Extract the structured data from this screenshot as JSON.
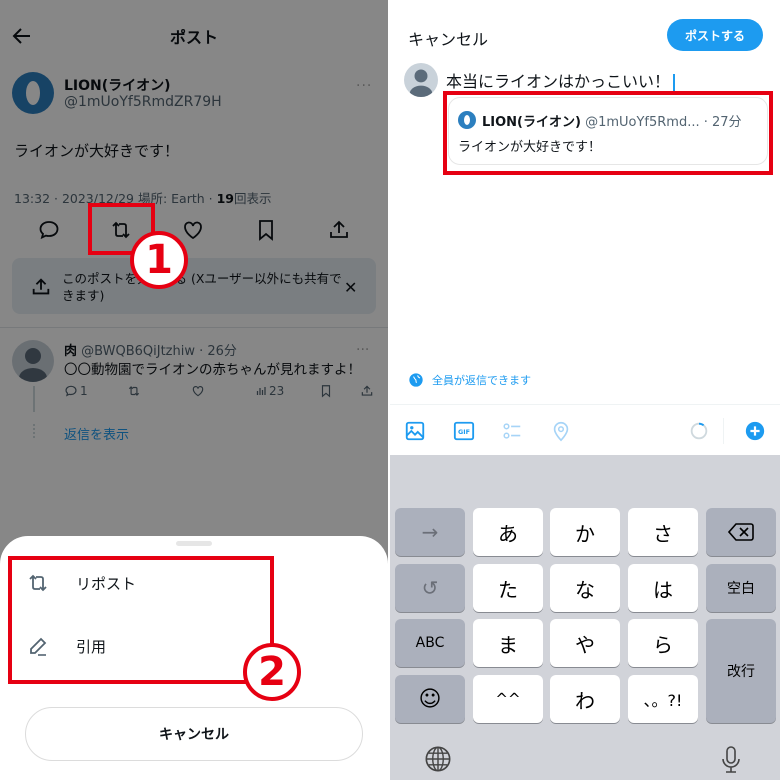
{
  "left": {
    "header": {
      "title": "ポスト"
    },
    "post": {
      "display_name": "LION(ライオン)",
      "handle": "@1mUoYf5RmdZR79H",
      "text": "ライオンが大好きです！",
      "meta_prefix": "13:32 · 2023/12/29 場所: Earth · ",
      "views_count": "19",
      "views_suffix": "回表示",
      "more": "···"
    },
    "actions": [
      "reply",
      "repost",
      "like",
      "bookmark",
      "share"
    ],
    "share_tip": {
      "text": "このポストを共有する (Xユーザー以外にも共有できます)",
      "close": "✕"
    },
    "reply": {
      "display_name": "肉",
      "handle_time": "@BWQB6QiJtzhiw · 26分",
      "text": "〇〇動物園でライオンの赤ちゃんが見れますよ！",
      "reply_count": "1",
      "views": "23",
      "more": "···"
    },
    "show_replies": "返信を表示",
    "sheet": {
      "items": [
        {
          "label": "リポスト",
          "icon": "repost-icon"
        },
        {
          "label": "引用",
          "icon": "pencil-icon"
        }
      ],
      "cancel": "キャンセル"
    },
    "annotations": {
      "step1": "1",
      "step2": "2",
      "accent": "#e60012"
    }
  },
  "right": {
    "cancel": "キャンセル",
    "post_button": "ポストする",
    "compose_text": "本当にライオンはかっこいい！",
    "quote": {
      "display_name": "LION(ライオン)",
      "handle_time": "@1mUoYf5Rmd... · 27分",
      "text": "ライオンが大好きです！"
    },
    "reply_setting": "全員が返信できます",
    "toolbar": [
      "image-icon",
      "gif-icon",
      "poll-icon",
      "location-icon",
      "char-counter",
      "add-post-icon"
    ],
    "keyboard": {
      "rows": [
        [
          "→",
          "あ",
          "か",
          "さ",
          "⌫"
        ],
        [
          "↺",
          "た",
          "な",
          "は",
          "空白"
        ],
        [
          "ABC",
          "ま",
          "や",
          "ら",
          "改行"
        ],
        [
          "☺",
          "^^",
          "わ",
          "、。?!"
        ]
      ]
    },
    "accent": "#1d9bf0"
  }
}
